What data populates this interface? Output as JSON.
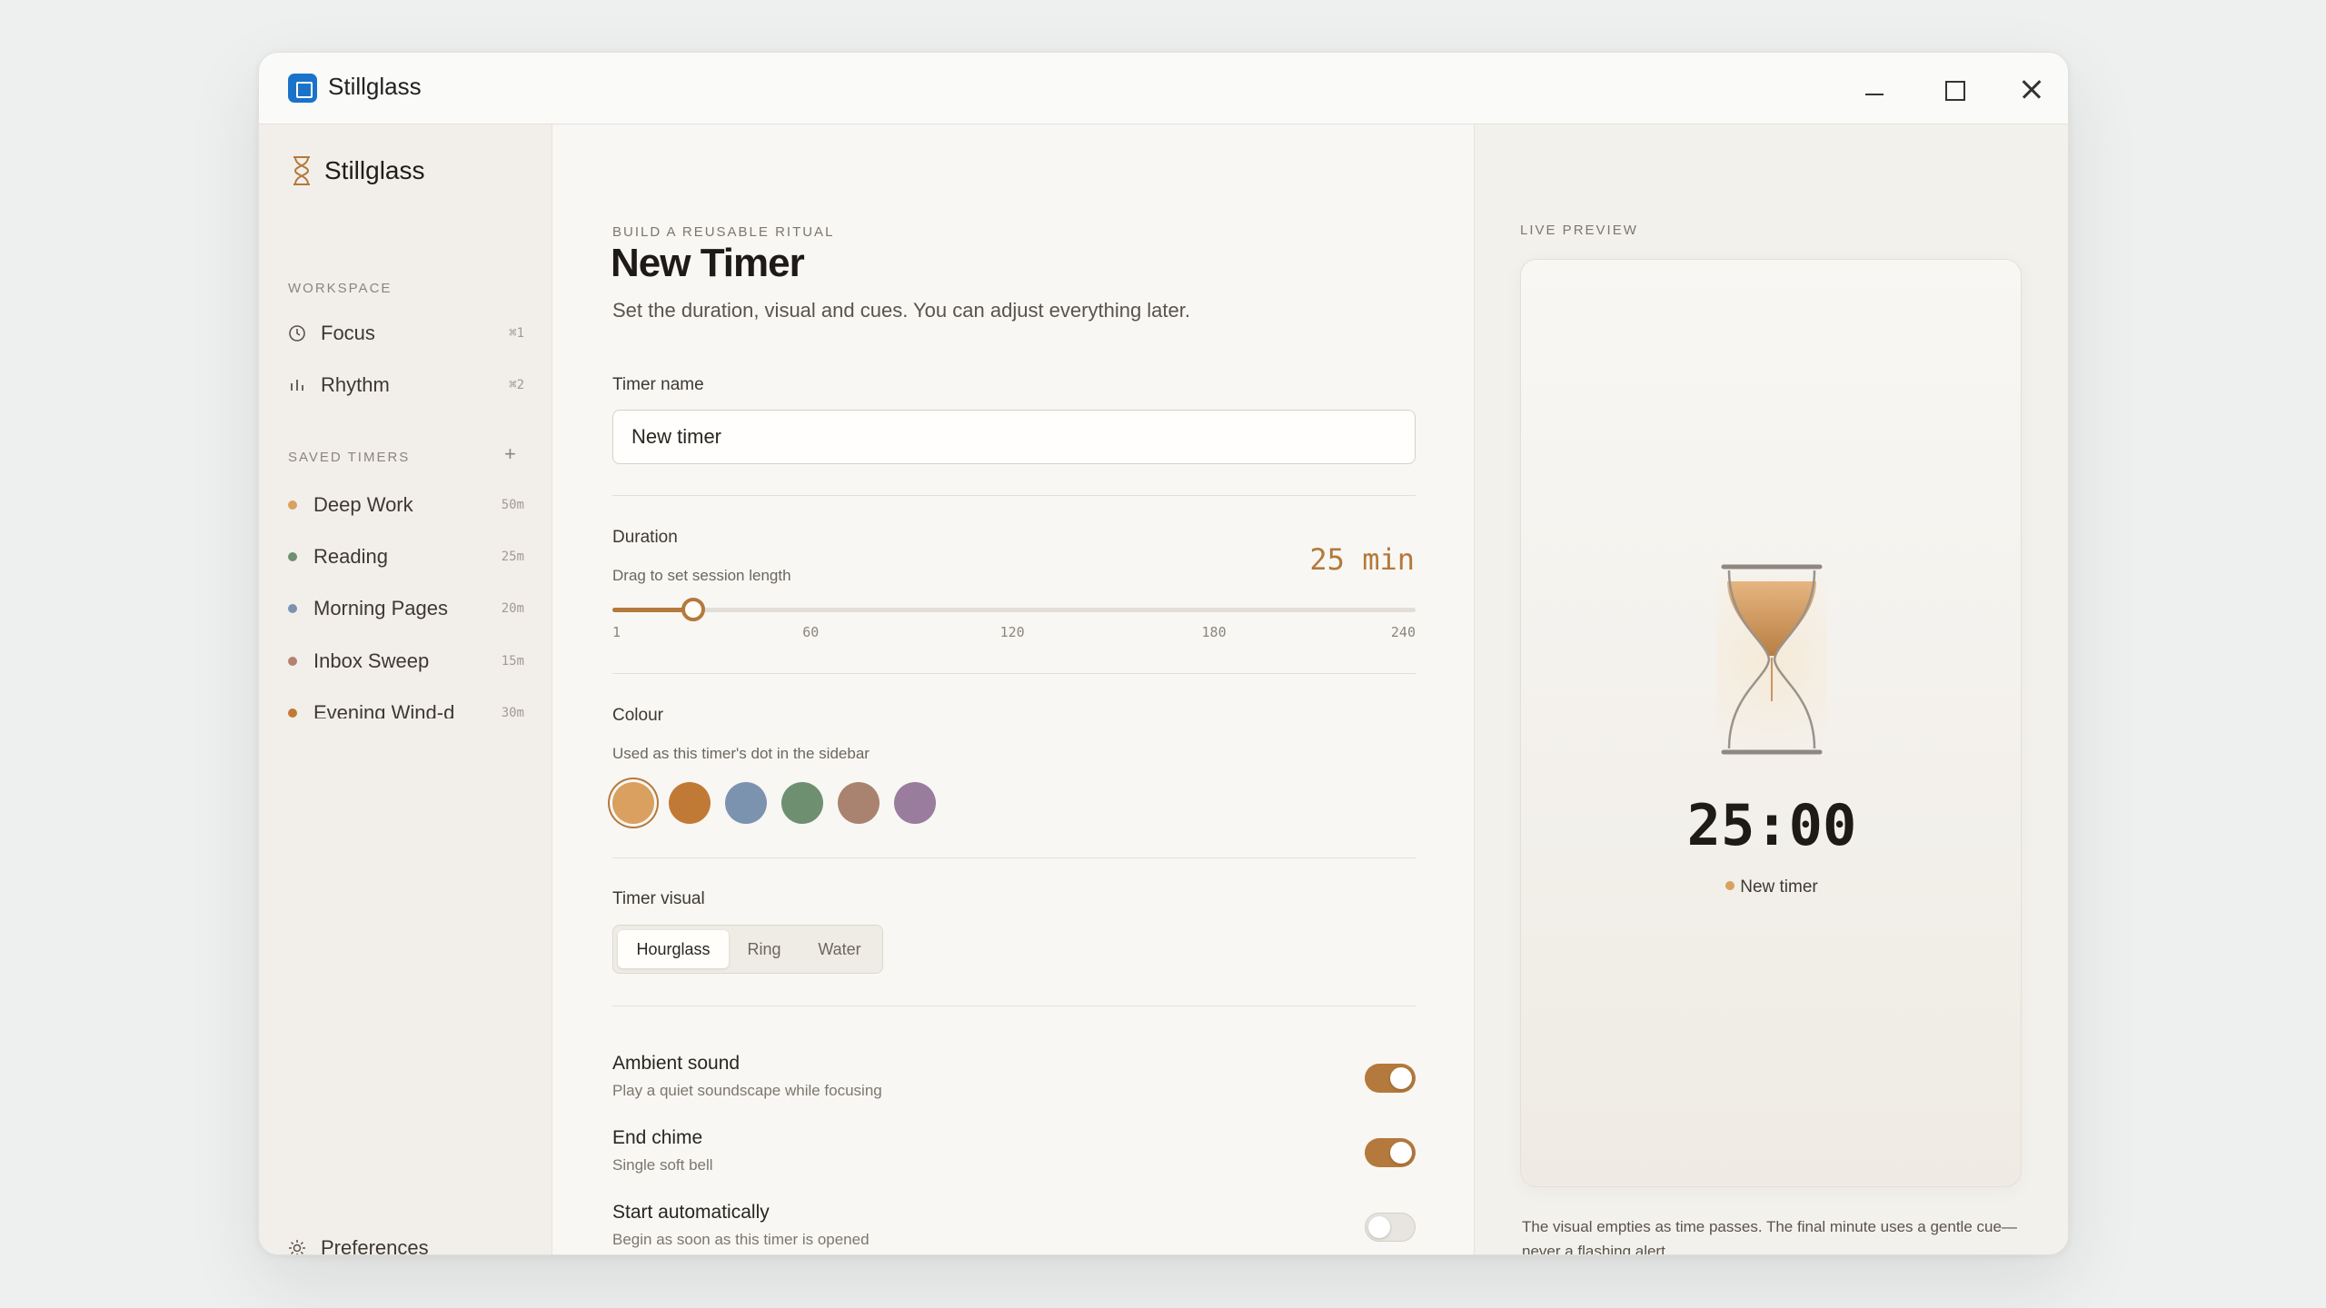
{
  "window": {
    "title": "Stillglass"
  },
  "sidebar": {
    "brand": "Stillglass",
    "workspace_label": "WORKSPACE",
    "nav": [
      {
        "label": "Focus",
        "shortcut": "⌘1",
        "icon": "clock-icon"
      },
      {
        "label": "Rhythm",
        "shortcut": "⌘2",
        "icon": "bars-icon"
      }
    ],
    "saved_label": "SAVED TIMERS",
    "add_icon": "plus-icon",
    "timers": [
      {
        "label": "Deep Work",
        "duration": "50m",
        "color": "#d9a05f"
      },
      {
        "label": "Reading",
        "duration": "25m",
        "color": "#6f8f71"
      },
      {
        "label": "Morning Pages",
        "duration": "20m",
        "color": "#7c93b0"
      },
      {
        "label": "Inbox Sweep",
        "duration": "15m",
        "color": "#b28270"
      },
      {
        "label": "Evening Wind-d",
        "duration": "30m",
        "color": "#c07a36"
      }
    ],
    "preferences_label": "Preferences"
  },
  "form": {
    "eyebrow": "BUILD A REUSABLE RITUAL",
    "title": "New Timer",
    "subtitle": "Set the duration, visual and cues. You can adjust everything later.",
    "name_label": "Timer name",
    "name_value": "New timer",
    "duration_label": "Duration",
    "duration_help": "Drag to set session length",
    "duration_value": "25 min",
    "duration_minutes": 25,
    "duration_range": [
      1,
      240
    ],
    "duration_ticks": [
      "1",
      "60",
      "120",
      "180",
      "240"
    ],
    "colour_label": "Colour",
    "colour_help": "Used as this timer's dot in the sidebar",
    "colours": [
      "#d9a05f",
      "#c07a36",
      "#7c93b0",
      "#6f8f71",
      "#a98370",
      "#9a7c9e"
    ],
    "selected_colour_index": 0,
    "visual_label": "Timer visual",
    "visual_options": [
      "Hourglass",
      "Ring",
      "Water"
    ],
    "visual_selected": "Hourglass",
    "toggles": [
      {
        "title": "Ambient sound",
        "desc": "Play a quiet soundscape while focusing",
        "on": true
      },
      {
        "title": "End chime",
        "desc": "Single soft bell",
        "on": true
      },
      {
        "title": "Start automatically",
        "desc": "Begin as soon as this timer is opened",
        "on": false
      }
    ]
  },
  "preview": {
    "label": "LIVE PREVIEW",
    "time": "25:00",
    "timer_name": "New timer",
    "dot_color": "#d9a05f",
    "note": "The visual empties as time passes. The final minute uses a gentle cue—never a flashing alert."
  },
  "colors": {
    "accent": "#b4793c"
  }
}
